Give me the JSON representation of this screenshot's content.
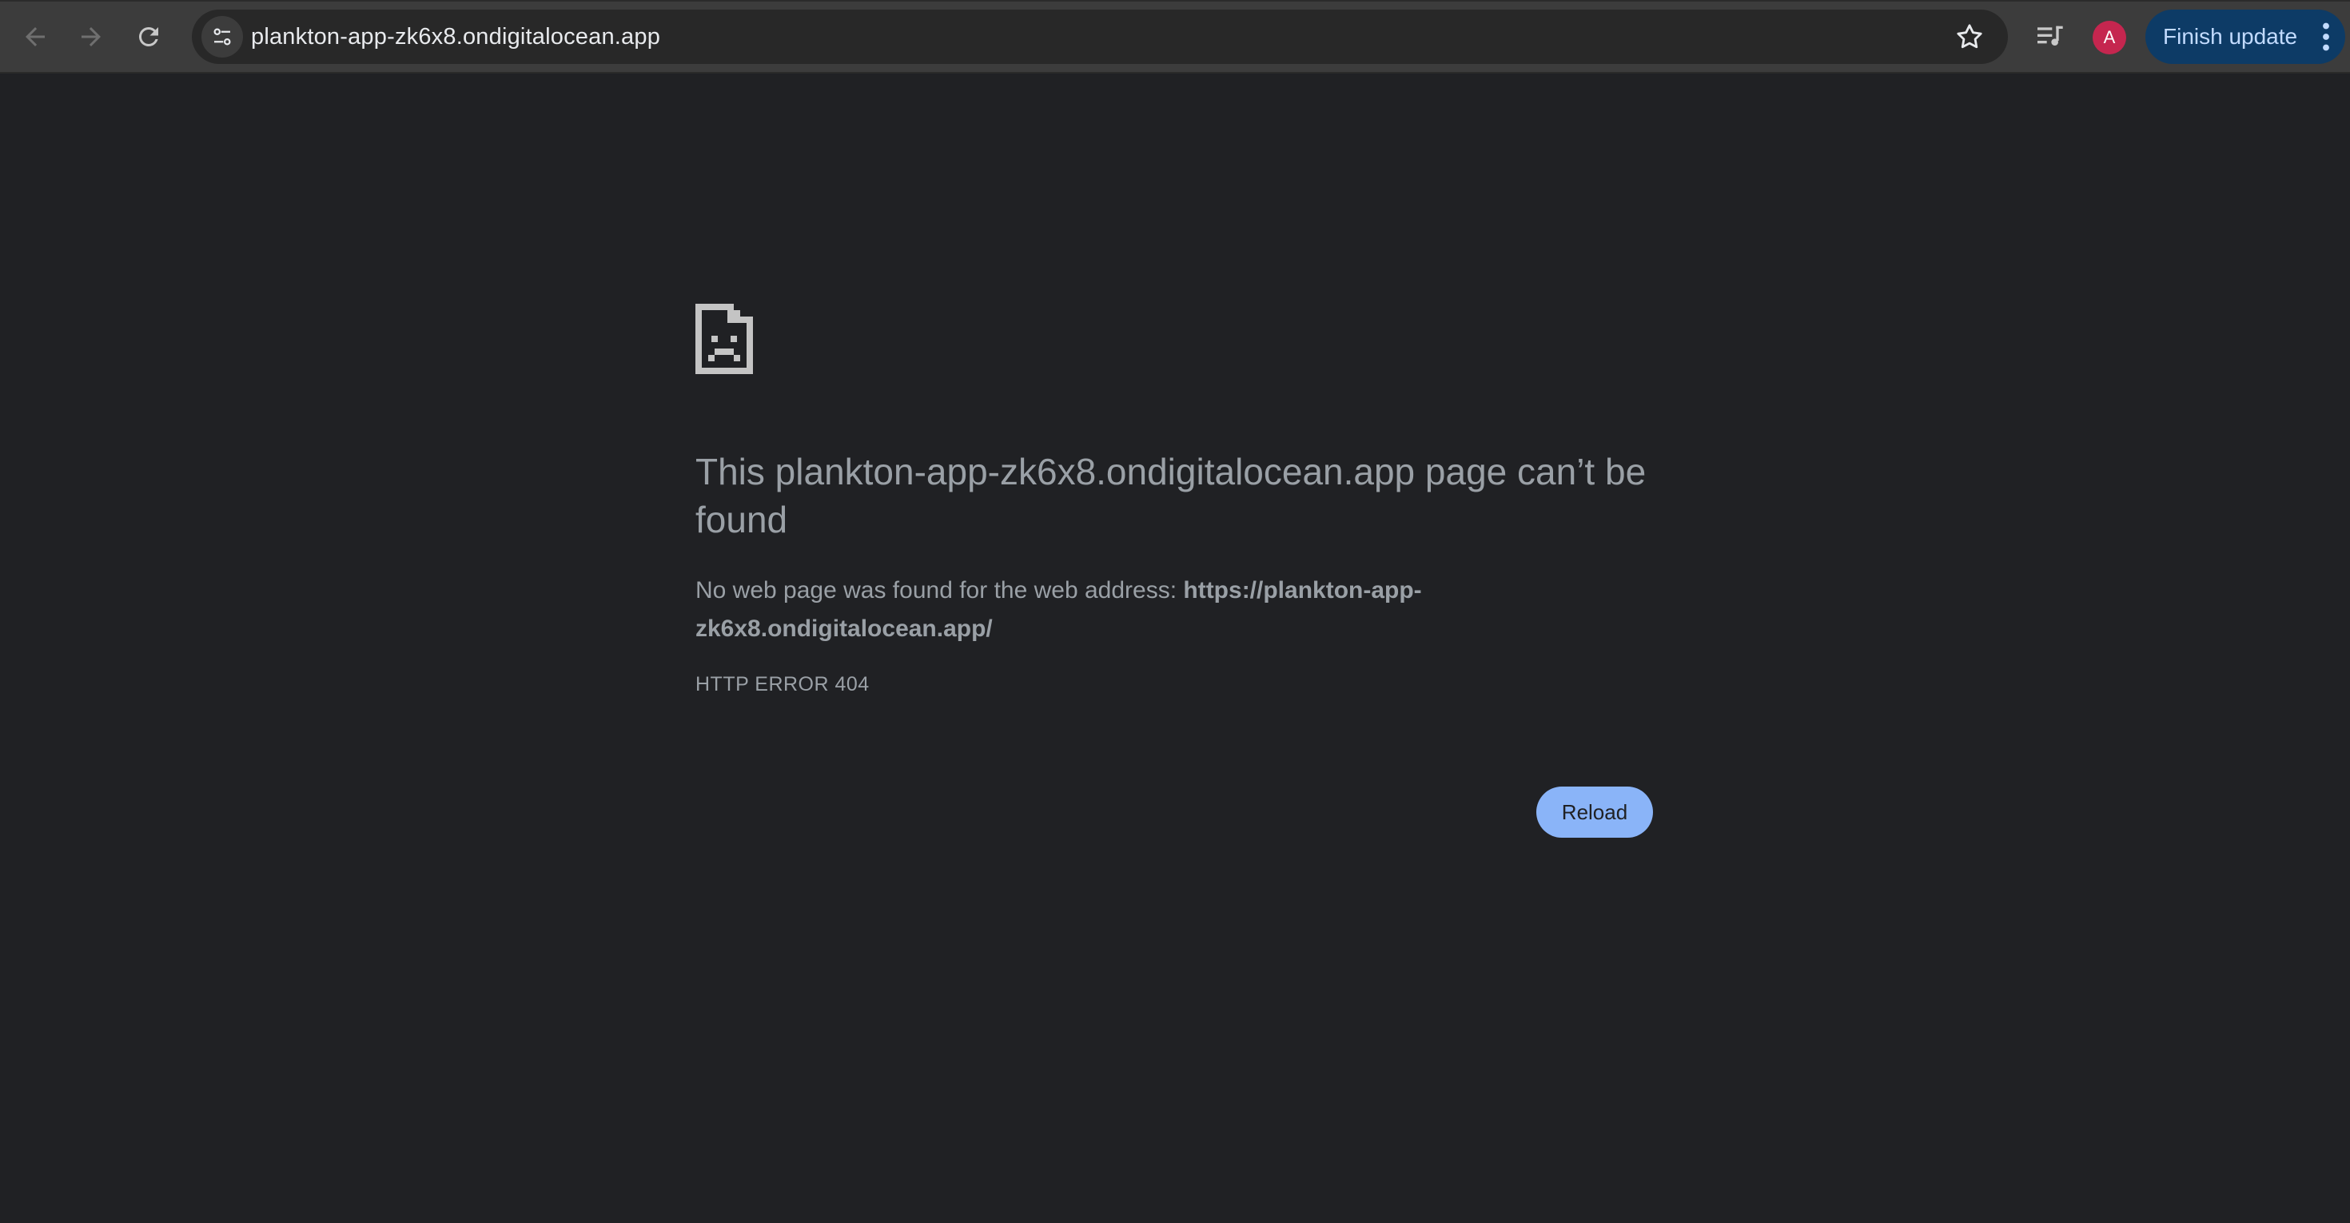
{
  "browser": {
    "url": "plankton-app-zk6x8.ondigitalocean.app",
    "profile_initial": "A",
    "update_label": "Finish update",
    "icons": {
      "back": "arrow-left-icon",
      "forward": "arrow-right-icon",
      "reload": "reload-icon",
      "site_info": "tune-icon",
      "bookmark": "star-icon",
      "media": "media-control-icon",
      "menu": "kebab-icon"
    },
    "colors": {
      "toolbar": "#3c3c3c",
      "omnibox": "#282828",
      "avatar": "#c5264f",
      "update_button": "#0d3b66"
    }
  },
  "error_page": {
    "icon": "sad-document-icon",
    "title": "This plankton-app-zk6x8.ondigitalocean.app page can’t be found",
    "description_prefix": "No web page was found for the web address: ",
    "description_url": "https://plankton-app-zk6x8.ondigitalocean.app/",
    "error_code": "HTTP ERROR 404",
    "reload_label": "Reload",
    "colors": {
      "background": "#202124",
      "text": "#9aa0a6",
      "button": "#8ab4f8"
    }
  }
}
